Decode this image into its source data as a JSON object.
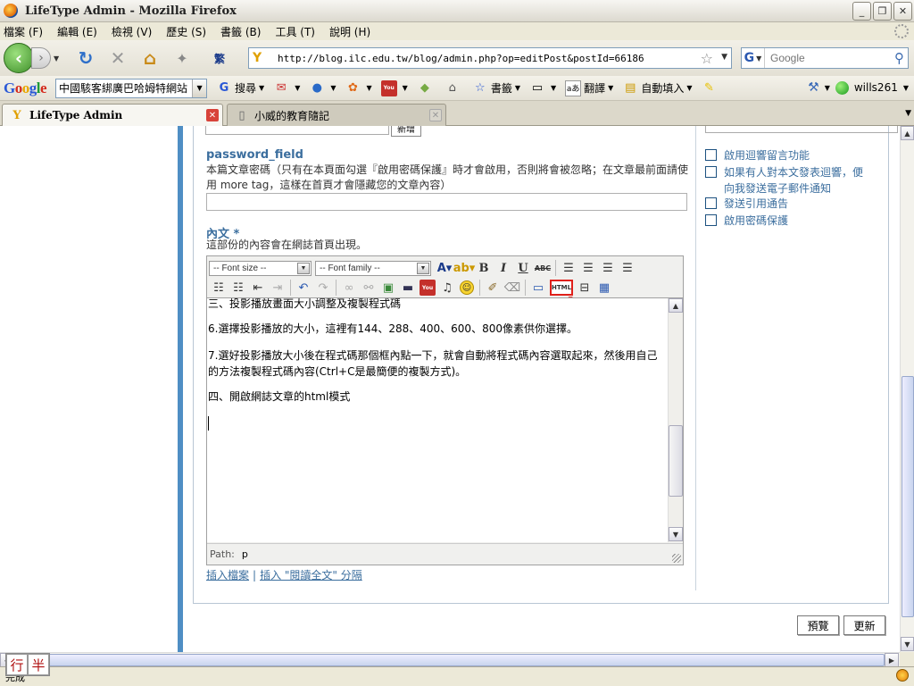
{
  "window": {
    "title": "LifeType Admin - Mozilla Firefox",
    "minimize": "_",
    "restore": "❐",
    "close": "✕"
  },
  "menu": {
    "items": [
      "檔案 (F)",
      "編輯 (E)",
      "檢視 (V)",
      "歷史 (S)",
      "書籤 (B)",
      "工具 (T)",
      "說明 (H)"
    ]
  },
  "nav": {
    "url": "http://blog.ilc.edu.tw/blog/admin.php?op=editPost&postId=66186",
    "kanji": "繁",
    "search_placeholder": "Google"
  },
  "google_toolbar": {
    "logo_letters": [
      "G",
      "o",
      "o",
      "g",
      "l",
      "e"
    ],
    "search_value": "中國駭客綁廣巴哈姆特網站",
    "search_label": "搜尋",
    "bookmarks_label": "書籤",
    "translate_label": "翻譯",
    "autofill_label": "自動填入",
    "user": "wills261"
  },
  "tabs": [
    {
      "label": "LifeType Admin",
      "active": true
    },
    {
      "label": "小威的教育隨記",
      "active": false
    }
  ],
  "form": {
    "top_button": "新增",
    "password_label": "password_field",
    "password_help": "本篇文章密碼（只有在本頁面勾選『啟用密碼保護』時才會啟用，否則將會被忽略；在文章最前面請使用 more tag，這樣在首頁才會隱藏您的文章內容）",
    "content_label": "內文 *",
    "content_help": "這部份的內容會在網誌首頁出現。"
  },
  "editor": {
    "font_size_placeholder": "-- Font size --",
    "font_family_placeholder": "-- Font family --",
    "html_button": "HTML",
    "annotation": "8",
    "lines": [
      "三、投影播放畫面大小調整及複製程式碼",
      "6.選擇投影播放的大小，這裡有144、288、400、600、800像素供你選擇。",
      "7.選好投影播放大小後在程式碼那個框內點一下，就會自動將程式碼內容選取起來，然後用自己的方法複製程式碼內容(Ctrl+C是最簡便的複製方式)。",
      "四、開啟網誌文章的html模式"
    ],
    "path_label": "Path:",
    "path_value": "p"
  },
  "links": {
    "insert_file": "插入檔案",
    "separator": "|",
    "insert_more": "插入 \"閱讀全文\" 分隔"
  },
  "options": [
    {
      "label": "啟用迴響留言功能"
    },
    {
      "label": "如果有人對本文發表迴響，便向我發送電子郵件通知"
    },
    {
      "label": "發送引用通告"
    },
    {
      "label": "啟用密碼保護"
    }
  ],
  "buttons": {
    "preview": "預覽",
    "update": "更新"
  },
  "statusbar": {
    "text": "完成",
    "ime_chars": [
      "行",
      "半"
    ]
  },
  "colors": {
    "label_blue": "#3b6e9e",
    "stripe_blue": "#4f8ec4",
    "highlight_red": "#e0201a"
  }
}
